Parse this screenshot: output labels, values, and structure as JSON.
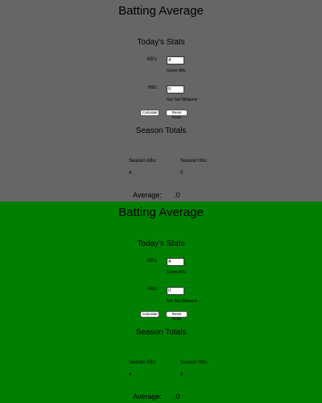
{
  "panels": [
    {
      "background": "#666666",
      "title": "Batting Average",
      "today_heading": "Today's Stats",
      "abs_label": "AB's:",
      "abs_value": "4",
      "abs_hint": "Game ABs",
      "hits_label": "Hits:",
      "hits_value": "0",
      "hits_hint": "Not Ted Williams!",
      "calculate_label": "Calculate",
      "reset_label": "Reset Fields",
      "season_heading": "Season Totals",
      "season_abs_label": "Season ABs:",
      "season_hits_label": "Season Hits:",
      "season_abs_value": "4",
      "season_hits_value": "0",
      "average_label": "Average:",
      "average_value": ".0"
    },
    {
      "background": "#008000",
      "title": "Batting Average",
      "today_heading": "Today's Stats",
      "abs_label": "AB's:",
      "abs_value": "4",
      "abs_hint": "Game ABs",
      "hits_label": "Hits:",
      "hits_value": "0",
      "hits_hint": "Not Ted Williams!",
      "calculate_label": "Calculate",
      "reset_label": "Reset Fields",
      "season_heading": "Season Totals",
      "season_abs_label": "Season ABs:",
      "season_hits_label": "Season Hits:",
      "season_abs_value": "4",
      "season_hits_value": "0",
      "average_label": "Average:",
      "average_value": ".0"
    }
  ]
}
